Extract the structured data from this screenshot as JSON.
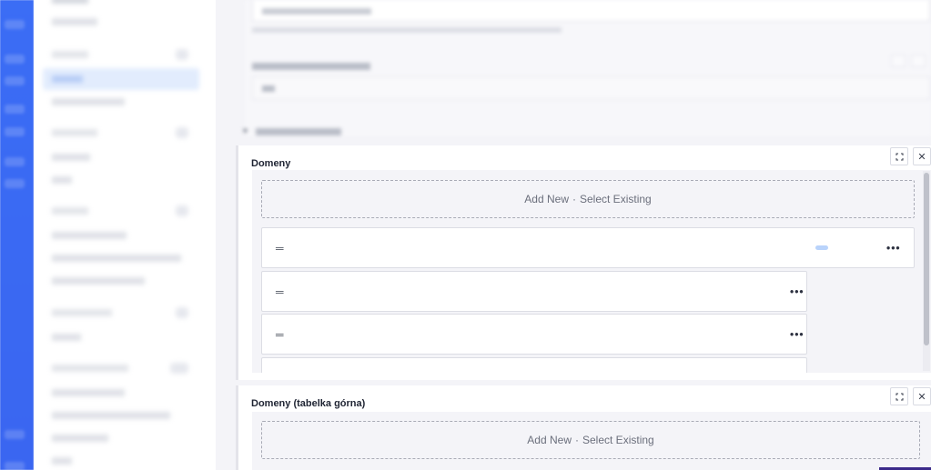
{
  "main": {
    "panels": [
      {
        "title": "Domeny",
        "add_new_label": "Add New",
        "separator": "·",
        "select_existing_label": "Select Existing",
        "expand_icon": "expand-icon",
        "close_icon": "close-icon"
      },
      {
        "title": "Domeny (tabelka górna)",
        "add_new_label": "Add New",
        "separator": "·",
        "select_existing_label": "Select Existing",
        "expand_icon": "expand-icon",
        "close_icon": "close-icon"
      }
    ],
    "item_icons": {
      "handle": "drag-handle-icon",
      "menu": "more-horizontal-icon"
    }
  },
  "colors": {
    "rail": "#3b6df5",
    "sidebar_active": "#e2ecfd",
    "panel_bg": "#ffffff",
    "body_bg": "#f4f4f8",
    "loader": "#b9d3fb"
  }
}
